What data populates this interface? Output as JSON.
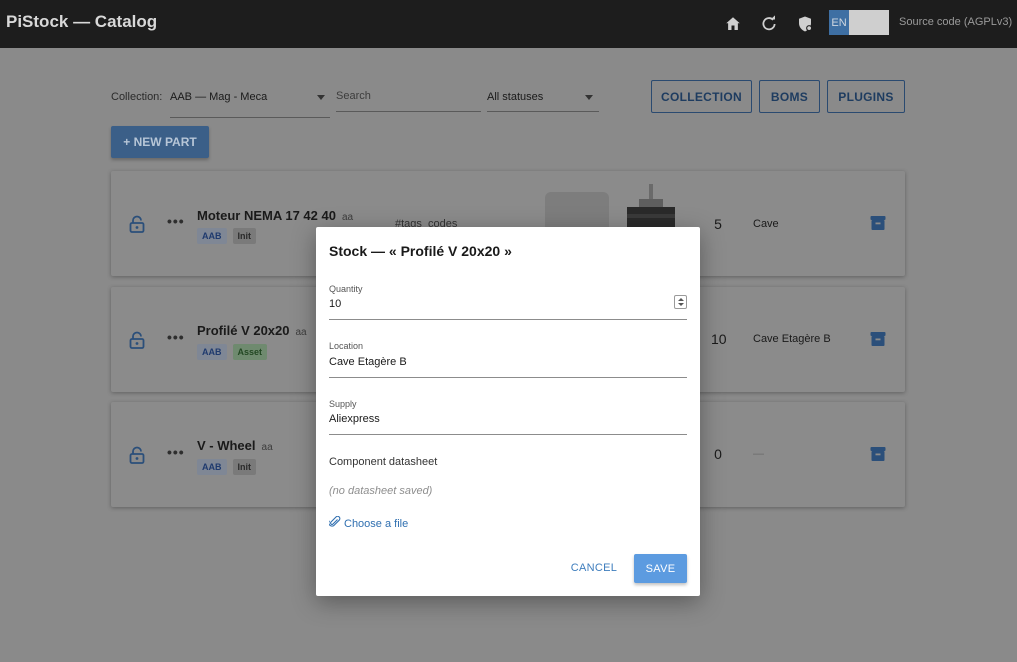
{
  "app": {
    "title": "PiStock — Catalog",
    "source_link": "Source code (AGPLv3)"
  },
  "topbar": {
    "lang": "EN",
    "icons": [
      "home-icon",
      "refresh-icon",
      "shield-icon"
    ]
  },
  "filters": {
    "collection_label": "Collection:",
    "collection_value": "AAB — Mag - Meca",
    "search_placeholder": "Search",
    "status_value": "All statuses"
  },
  "buttons": {
    "collection": "COLLECTION",
    "boms": "BOMS",
    "plugins": "PLUGINS",
    "new_part": "+ NEW PART"
  },
  "parts": [
    {
      "name": "Moteur NEMA 17 42 40",
      "suffix": "aa",
      "chips": [
        "AAB",
        "Init"
      ],
      "tags": "#tags_codes",
      "quantity": "5",
      "location": "Cave"
    },
    {
      "name": "Profilé V 20x20",
      "suffix": "aa",
      "chips": [
        "AAB",
        "Asset"
      ],
      "quantity": "10",
      "location": "Cave Etagère B"
    },
    {
      "name": "V - Wheel",
      "suffix": "aa",
      "chips": [
        "AAB",
        "Init"
      ],
      "quantity": "0",
      "location": "—"
    }
  ],
  "dialog": {
    "title": "Stock — « Profilé V 20x20 »",
    "quantity_label": "Quantity",
    "quantity_value": "10",
    "location_label": "Location",
    "location_value": "Cave Etagère B",
    "supply_label": "Supply",
    "supply_value": "Aliexpress",
    "datasheet_label": "Component datasheet",
    "datasheet_empty": "(no datasheet saved)",
    "choose_file": "Choose a file",
    "cancel": "CANCEL",
    "save": "SAVE"
  }
}
